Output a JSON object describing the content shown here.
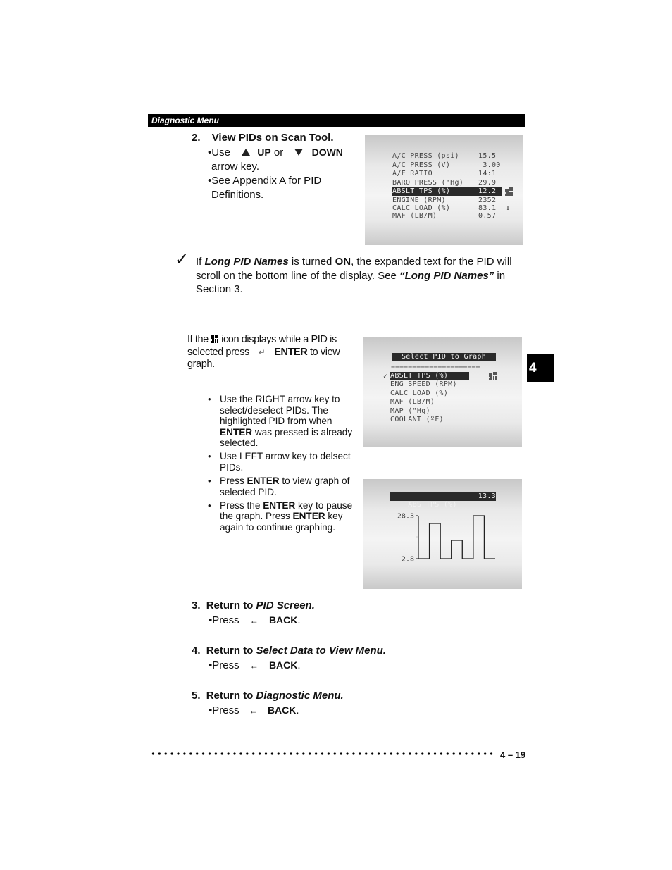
{
  "header": {
    "title": "Diagnostic Menu"
  },
  "section_tab": "4",
  "step2": {
    "number": "2.",
    "title": "View PIDs on Scan Tool.",
    "bullet1_prefix": "•Use",
    "up_label": "UP",
    "or": "or",
    "down_label": "DOWN",
    "bullet1_suffix": "arrow key.",
    "bullet2": "•See Appendix A for PID",
    "bullet2_cont": "Definitions."
  },
  "pid_screen": {
    "rows": [
      {
        "name": "A/C PRESS (psi)",
        "value": "15.5"
      },
      {
        "name": "A/C PRESS (V)",
        "value": " 3.00"
      },
      {
        "name": "A/F RATIO",
        "value": "14:1"
      },
      {
        "name": "BARO PRESS (\"Hg)",
        "value": "29.9"
      },
      {
        "name": "ABSLT TPS (%)",
        "value": "12.2",
        "highlighted": true,
        "icon": "graph-icon"
      },
      {
        "name": "ENGINE (RPM)",
        "value": "2352"
      },
      {
        "name": "CALC LOAD (%)",
        "value": "83.1",
        "icon": "scroll-down-arrow-icon"
      },
      {
        "name": "MAF (LB/M)",
        "value": "0.57"
      }
    ]
  },
  "note": {
    "icon": "checkmark-icon",
    "t1": "If ",
    "t2": "Long PID Names",
    "t3": " is turned ",
    "t4": "ON",
    "t5": ", the expanded text for the PID will scroll on the bottom line of the display. See ",
    "t6": "“Long PID Names”",
    "t7": " in Section 3."
  },
  "graph_intro": {
    "t1": "If the",
    "t2": "icon displays while a PID is selected press",
    "enter": "ENTER",
    "t3": "to view graph."
  },
  "select_screen": {
    "title": "Select PID to Graph",
    "separator": "=====================",
    "check": "✓",
    "items": [
      {
        "name": "ABSLT TPS (%)",
        "selected": true,
        "highlighted": true
      },
      {
        "name": "ENG SPEED (RPM)"
      },
      {
        "name": "CALC LOAD (%)"
      },
      {
        "name": "MAF (LB/M)"
      },
      {
        "name": "MAP (\"Hg)"
      },
      {
        "name": "COOLANT (ºF)"
      }
    ]
  },
  "bullets": [
    {
      "parts": [
        "Use the RIGHT arrow key to select/deselect PIDs. The highlighted PID from when ",
        "ENTER",
        " was pressed is already selected."
      ]
    },
    {
      "parts": [
        "Use LEFT arrow key to delsect PIDs.",
        "",
        ""
      ]
    },
    {
      "parts": [
        "Press ",
        "ENTER",
        " to view graph of selected PID."
      ]
    },
    {
      "parts": [
        "Press the ",
        "ENTER",
        " key to pause the graph. Press ",
        "ENTER",
        " key again to continue graphing."
      ]
    }
  ],
  "graph_screen": {
    "label": "ABS TPS (%)",
    "value": "13.3"
  },
  "chart_data": {
    "type": "line",
    "title": "ABS TPS (%)",
    "current_value": 13.3,
    "ylim": [
      -2.8,
      28.3
    ],
    "y_tick_labels": [
      "28.3",
      "-2.8"
    ],
    "step": true,
    "y": [
      -2.8,
      22.7,
      -2.8,
      10.5,
      -2.8,
      28.3,
      -2.8
    ]
  },
  "step3": {
    "number": "3.",
    "title_plain": "Return to ",
    "title_italic": "PID Screen.",
    "press": "•Press",
    "key": "BACK",
    "period": "."
  },
  "step4": {
    "number": "4.",
    "title_plain": "Return to ",
    "title_italic": "Select Data to View Menu.",
    "press": "•Press",
    "key": "BACK",
    "period": "."
  },
  "step5": {
    "number": "5.",
    "title_plain": "Return to ",
    "title_italic": "Diagnostic Menu.",
    "press": "•Press",
    "key": "BACK",
    "period": "."
  },
  "footer": {
    "page": "4 – 19"
  }
}
